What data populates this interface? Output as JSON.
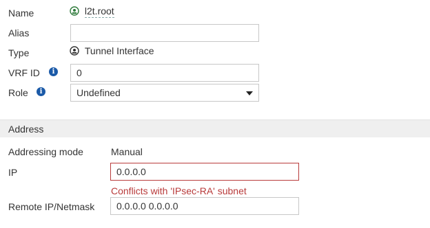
{
  "fields": {
    "name": {
      "label": "Name",
      "value": "l2t.root",
      "icon": "tunnel-interface-icon"
    },
    "alias": {
      "label": "Alias",
      "value": ""
    },
    "type": {
      "label": "Type",
      "value": "Tunnel Interface",
      "icon": "tunnel-interface-icon"
    },
    "vrf_id": {
      "label": "VRF ID",
      "value": "0",
      "icon": "info-icon"
    },
    "role": {
      "label": "Role",
      "value": "Undefined",
      "icon": "info-icon"
    }
  },
  "address_section": {
    "title": "Address",
    "addressing_mode": {
      "label": "Addressing mode",
      "value": "Manual"
    },
    "ip": {
      "label": "IP",
      "value": "0.0.0.0",
      "error": "Conflicts with 'IPsec-RA' subnet"
    },
    "remote_ip": {
      "label": "Remote IP/Netmask",
      "value": "0.0.0.0 0.0.0.0"
    }
  },
  "colors": {
    "error": "#b83a3a",
    "info_icon": "#1b5aa8",
    "section_bg": "#efefef"
  }
}
